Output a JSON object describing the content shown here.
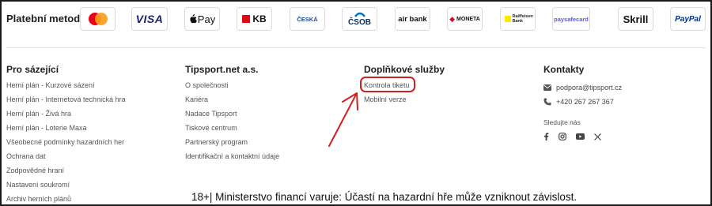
{
  "payments": {
    "title": "Platební metody",
    "logos": [
      {
        "name": "mastercard-logo",
        "text": ""
      },
      {
        "name": "visa-logo",
        "text": "VISA"
      },
      {
        "name": "apple-pay-logo",
        "text": "Pay"
      },
      {
        "name": "kb-logo",
        "text": "KB"
      },
      {
        "name": "ceska-sporitelna-logo",
        "text": "ČESKÁ"
      },
      {
        "name": "csob-logo",
        "text": "ČSOB"
      },
      {
        "name": "air-bank-logo",
        "text": "air bank"
      },
      {
        "name": "moneta-logo",
        "text": "MONETA"
      },
      {
        "name": "raiffeisen-logo",
        "text": "Raiffeisen Bank"
      },
      {
        "name": "paysafecard-logo",
        "text": "paysafecard"
      },
      {
        "name": "skrill-logo",
        "text": "Skrill"
      },
      {
        "name": "paypal-logo",
        "text": "PayPal"
      }
    ],
    "colors": {
      "mastercard_red": "#eb001b",
      "mastercard_orange": "#f79e1b",
      "visa": "#1a1f71",
      "kb": "#e30613",
      "csob": "#0074c4",
      "paysafecard": "#5e5bd5",
      "paypal": "#003087"
    }
  },
  "columns": {
    "players": {
      "heading": "Pro sázející",
      "links": [
        "Herní plán - Kurzové sázení",
        "Herní plán - Internetová technická hra",
        "Herní plán - Živá hra",
        "Herní plán - Loterie Maxa",
        "Všeobecné podmínky hazardních her",
        "Ochrana dat",
        "Zodpovědné hraní",
        "Nastavení soukromí",
        "Archiv herních plánů"
      ]
    },
    "company": {
      "heading": "Tipsport.net a.s.",
      "links": [
        "O společnosti",
        "Kariéra",
        "Nadace Tipsport",
        "Tiskové centrum",
        "Partnerský program",
        "Identifikační a kontaktní údaje"
      ]
    },
    "services": {
      "heading": "Doplňkové služby",
      "links": [
        "Kontrola tiketu",
        "Mobilní verze"
      ]
    },
    "contacts": {
      "heading": "Kontakty",
      "email": "podpora@tipsport.cz",
      "phone": "+420 267 267 367",
      "follow_label": "Sledujte nás",
      "social_icons": [
        "facebook-icon",
        "instagram-icon",
        "youtube-icon",
        "x-icon"
      ]
    }
  },
  "annotation": {
    "color": "#cf2020"
  },
  "warning": "18+| Ministerstvo financí varuje: Účastí na hazardní hře může vzniknout závislost."
}
